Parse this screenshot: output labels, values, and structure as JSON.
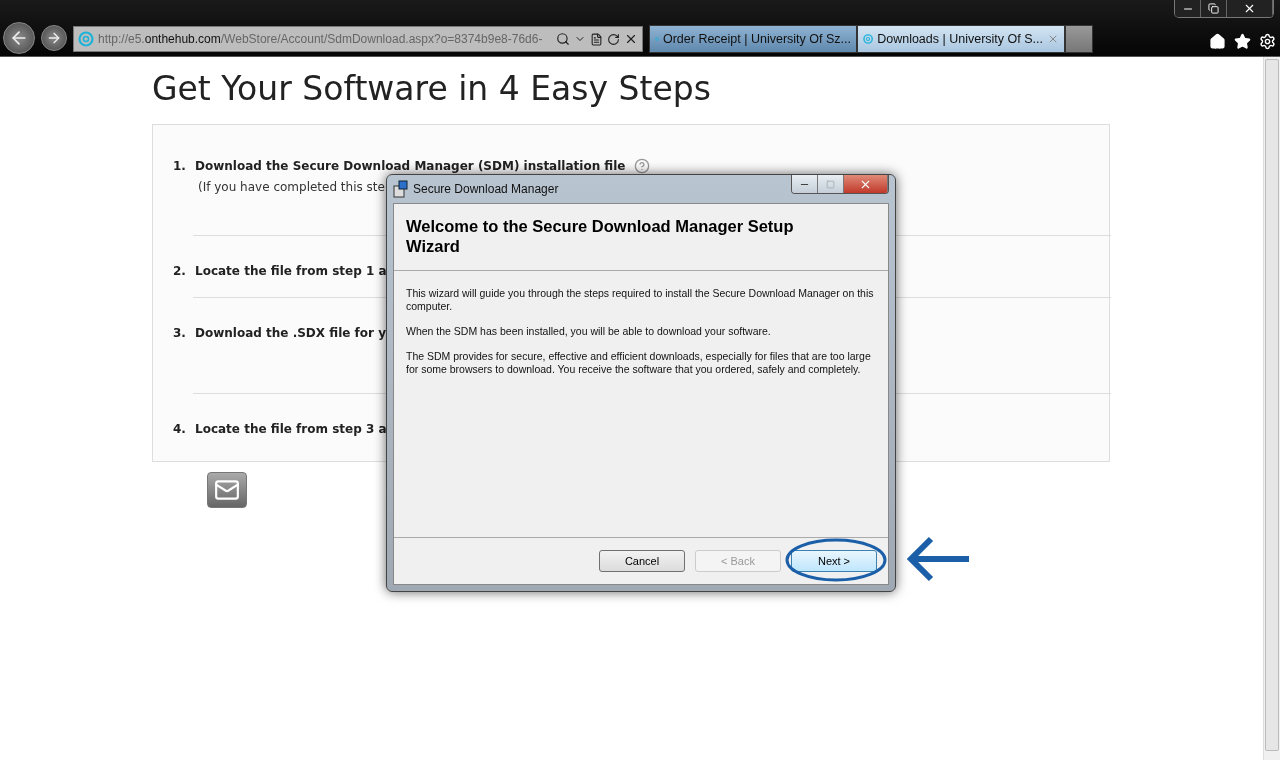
{
  "browser": {
    "address": {
      "prefix": "http://e5.",
      "domain": "onthehub.com",
      "path": "/WebStore/Account/SdmDownload.aspx?o=8374b9e8-76d6-"
    },
    "tabs": [
      {
        "label": "Order Receipt | University Of Sz...",
        "selected": false
      },
      {
        "label": "Downloads | University Of S...",
        "selected": true
      }
    ]
  },
  "page": {
    "title": "Get Your Software in 4 Easy Steps",
    "steps": [
      {
        "number": "1.",
        "text": "Download the Secure Download Manager (SDM) installation file",
        "note": "(If you have completed this ste",
        "help": true
      },
      {
        "number": "2.",
        "text": "Locate the file from step 1 a",
        "help": false
      },
      {
        "number": "3.",
        "text": "Download the .SDX file for y",
        "help": false
      },
      {
        "number": "4.",
        "text": "Locate the file from step 3 a",
        "help": false
      }
    ]
  },
  "dialog": {
    "title": "Secure Download Manager",
    "heading": "Welcome to the Secure Download Manager Setup Wizard",
    "paragraphs": [
      "This wizard will guide you through the steps required to install the Secure Download Manager on this computer.",
      "When the SDM has been installed, you will be able to download your software.",
      "The SDM provides for secure, effective and efficient downloads, especially for files that are too large for some browsers to download.  You receive the software that you ordered, safely and completely."
    ],
    "buttons": [
      {
        "label": "Cancel",
        "disabled": false,
        "selected": false
      },
      {
        "label": "< Back",
        "disabled": true,
        "selected": false
      },
      {
        "label": "Next >",
        "disabled": false,
        "selected": true
      }
    ]
  }
}
